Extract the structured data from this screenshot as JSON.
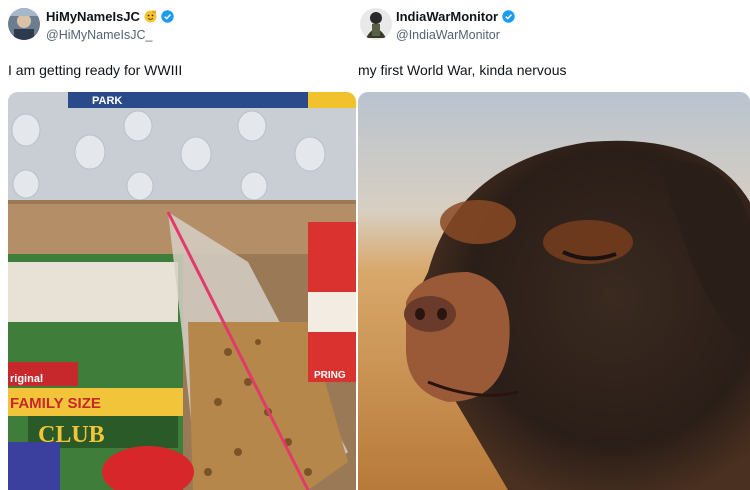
{
  "tweets": [
    {
      "display_name": "HiMyNameIsJC",
      "handle": "@HiMyNameIsJC_",
      "text": "I am getting ready for WWIII",
      "verified_icon": "verified-badge-icon",
      "emoji_icon": "saluting-face-emoji",
      "photo_labels": {
        "water_brand": "PARK",
        "cracker_box_line1": "riginal",
        "cracker_box_line2": "FAMILY SIZE",
        "cracker_box_brand": "CLUB",
        "can_brand": "PRING"
      }
    },
    {
      "display_name": "IndiaWarMonitor",
      "handle": "@IndiaWarMonitor",
      "text": "my first World War, kinda nervous",
      "verified_icon": "verified-badge-icon"
    }
  ],
  "colors": {
    "verified_blue": "#1d9bf0",
    "handle_gray": "#536471",
    "text_black": "#0f1419"
  }
}
